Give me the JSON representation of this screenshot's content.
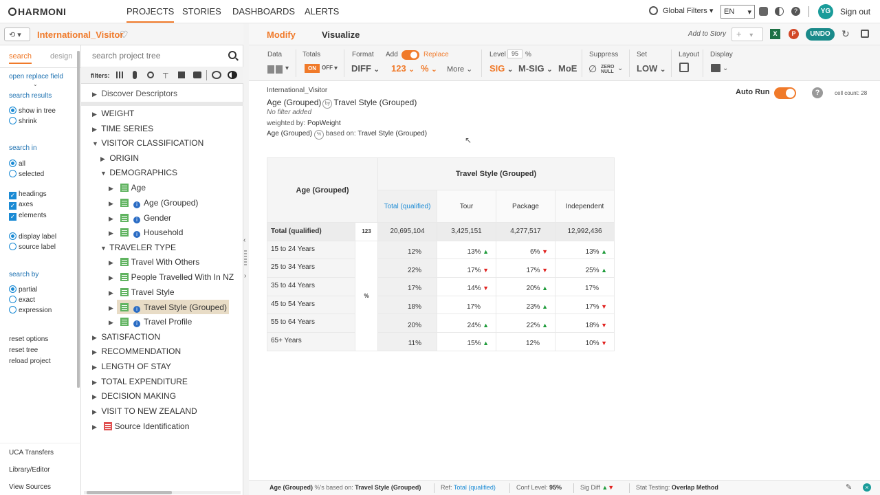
{
  "app": {
    "logo": "HARMONI"
  },
  "nav": {
    "items": [
      "PROJECTS",
      "STORIES",
      "DASHBOARDS",
      "ALERTS"
    ]
  },
  "topright": {
    "global_filters": "Global Filters",
    "lang": "EN",
    "avatar": "YG",
    "signout": "Sign out"
  },
  "project": {
    "name": "International_Visitor"
  },
  "modes": {
    "modify": "Modify",
    "visualize": "Visualize",
    "add_to_story": "Add to Story",
    "undo": "UNDO"
  },
  "toolbar": {
    "data": "Data",
    "totals": "Totals",
    "totals_on": "ON",
    "totals_off": "OFF",
    "format": "Format",
    "format_val": "DIFF",
    "add": "Add",
    "replace": "Replace",
    "add_num": "123",
    "add_pct": "%",
    "more": "More",
    "level": "Level",
    "level_val": "95",
    "level_pct": "%",
    "sig": "SIG",
    "msig": "M-SIG",
    "moe": "MoE",
    "suppress": "Suppress",
    "zero_null": "ZERO NULL",
    "set": "Set",
    "set_val": "LOW",
    "layout": "Layout",
    "display": "Display"
  },
  "left": {
    "tab_search": "search",
    "tab_design": "design",
    "open_replace": "open replace field",
    "search_results": "search results",
    "show_in_tree": "show in tree",
    "shrink": "shrink",
    "search_in": "search in",
    "all": "all",
    "selected": "selected",
    "headings": "headings",
    "axes": "axes",
    "elements": "elements",
    "display_label": "display label",
    "source_label": "source label",
    "search_by": "search by",
    "partial": "partial",
    "exact": "exact",
    "expression": "expression",
    "reset_options": "reset options",
    "reset_tree": "reset tree",
    "reload_project": "reload project",
    "uca": "UCA Transfers",
    "library": "Library/Editor",
    "view_sources": "View Sources"
  },
  "tree": {
    "search_placeholder": "search project tree",
    "filters_label": "filters:",
    "nodes": {
      "discover": "Discover Descriptors",
      "weight": "WEIGHT",
      "time_series": "TIME SERIES",
      "visitor_class": "VISITOR CLASSIFICATION",
      "origin": "ORIGIN",
      "demographics": "DEMOGRAPHICS",
      "age": "Age",
      "age_grouped": "Age (Grouped)",
      "gender": "Gender",
      "household": "Household",
      "traveler_type": "TRAVELER TYPE",
      "travel_with_others": "Travel With Others",
      "people_travelled": "People Travelled With In NZ",
      "travel_style": "Travel Style",
      "travel_style_grouped": "Travel Style (Grouped)",
      "travel_profile": "Travel Profile",
      "satisfaction": "SATISFACTION",
      "recommendation": "RECOMMENDATION",
      "length_of_stay": "LENGTH OF STAY",
      "total_expenditure": "TOTAL EXPENDITURE",
      "decision_making": "DECISION MAKING",
      "visit_nz": "VISIT TO NEW ZEALAND",
      "source_id": "Source Identification"
    }
  },
  "report": {
    "dataset": "International_Visitor",
    "row_var": "Age (Grouped)",
    "by": "by",
    "col_var": "Travel Style (Grouped)",
    "no_filter": "No filter added",
    "weighted_by": "weighted by:",
    "weight": "PopWeight",
    "pct_of": "Age (Grouped)",
    "pct_icon": "%",
    "based_on": "based on:",
    "based_on_val": "Travel Style (Grouped)",
    "auto_run": "Auto Run",
    "cell_count": "cell count: 28"
  },
  "table": {
    "row_header": "Age (Grouped)",
    "col_header": "Travel Style (Grouped)",
    "columns": [
      "Total (qualified)",
      "Tour",
      "Package",
      "Independent"
    ],
    "total_row": {
      "label": "Total (qualified)",
      "stat": "123",
      "values": [
        "20,695,104",
        "3,425,151",
        "4,277,517",
        "12,992,436"
      ]
    },
    "pct_stat": "%",
    "rows": [
      {
        "label": "15 to 24 Years",
        "values": [
          "12%",
          "13%",
          "6%",
          "13%"
        ],
        "sig": [
          "",
          "up",
          "down",
          "up"
        ]
      },
      {
        "label": "25 to 34 Years",
        "values": [
          "22%",
          "17%",
          "17%",
          "25%"
        ],
        "sig": [
          "",
          "down",
          "down",
          "up"
        ]
      },
      {
        "label": "35 to 44 Years",
        "values": [
          "17%",
          "14%",
          "20%",
          "17%"
        ],
        "sig": [
          "",
          "down",
          "up",
          ""
        ]
      },
      {
        "label": "45 to 54 Years",
        "values": [
          "18%",
          "17%",
          "23%",
          "17%"
        ],
        "sig": [
          "",
          "",
          "up",
          "down"
        ]
      },
      {
        "label": "55 to 64 Years",
        "values": [
          "20%",
          "24%",
          "22%",
          "18%"
        ],
        "sig": [
          "",
          "up",
          "up",
          "down"
        ]
      },
      {
        "label": "65+ Years",
        "values": [
          "11%",
          "15%",
          "12%",
          "10%"
        ],
        "sig": [
          "",
          "up",
          "",
          "down"
        ]
      }
    ]
  },
  "status": {
    "var": "Age (Grouped)",
    "pct_based": "%'s based on:",
    "pct_based_val": "Travel Style (Grouped)",
    "ref": "Ref:",
    "ref_val": "Total (qualified)",
    "conf": "Conf Level:",
    "conf_val": "95%",
    "sig": "Sig Diff",
    "stat": "Stat Testing:",
    "stat_val": "Overlap Method"
  },
  "colors": {
    "accent": "#f07a2a",
    "teal": "#1a9c9a",
    "link": "#1a6fb0",
    "up": "#1e9b3a",
    "down": "#e0221f"
  }
}
